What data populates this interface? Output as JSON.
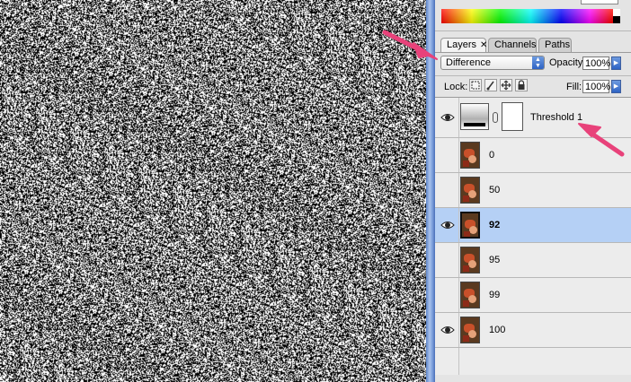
{
  "panel": {
    "tabs": [
      {
        "label": "Layers",
        "close": "✕"
      },
      {
        "label": "Channels"
      },
      {
        "label": "Paths"
      }
    ],
    "blend_mode": "Difference",
    "opacity_label": "Opacity:",
    "opacity_value": "100%",
    "lock_label": "Lock:",
    "fill_label": "Fill:",
    "fill_value": "100%"
  },
  "layers": [
    {
      "name": "Threshold 1",
      "type": "adjustment",
      "visible": true,
      "selected": false
    },
    {
      "name": "0",
      "type": "image",
      "visible": false,
      "selected": false
    },
    {
      "name": "50",
      "type": "image",
      "visible": false,
      "selected": false
    },
    {
      "name": "92",
      "type": "image",
      "visible": true,
      "selected": true
    },
    {
      "name": "95",
      "type": "image",
      "visible": false,
      "selected": false
    },
    {
      "name": "99",
      "type": "image",
      "visible": false,
      "selected": false
    },
    {
      "name": "100",
      "type": "image",
      "visible": true,
      "selected": false
    }
  ],
  "colors": {
    "selected_row": "#b5d0f5",
    "annotation_arrow": "#e8427a",
    "scrollbar": "#7c9fdc"
  }
}
